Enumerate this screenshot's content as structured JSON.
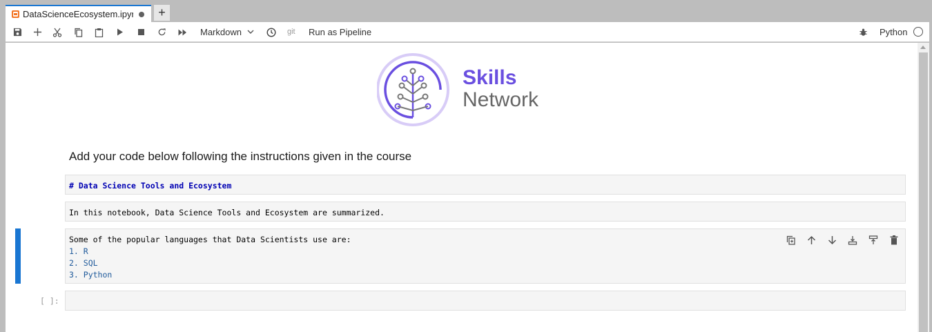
{
  "tab": {
    "title": "DataScienceEcosystem.ipynb",
    "new_tab_label": "+"
  },
  "toolbar": {
    "cell_type": "Markdown",
    "git_label": "git",
    "run_pipeline": "Run as Pipeline",
    "kernel_name": "Python"
  },
  "logo": {
    "line1": "Skills",
    "line2": "Network"
  },
  "heading": "Add your code below following the instructions given in the course",
  "cells": [
    {
      "text": "# Data Science Tools and Ecosystem"
    },
    {
      "text": "In this notebook, Data Science Tools and Ecosystem are summarized."
    },
    {
      "intro": "Some of the popular languages that Data Scientists use are:",
      "items": [
        "1. R",
        "2. SQL",
        "3. Python"
      ]
    },
    {
      "prompt": "[ ]:",
      "text": ""
    }
  ],
  "colors": {
    "accent": "#1976d2",
    "brand": "#6a4fe0",
    "tab_icon": "#f37626"
  }
}
